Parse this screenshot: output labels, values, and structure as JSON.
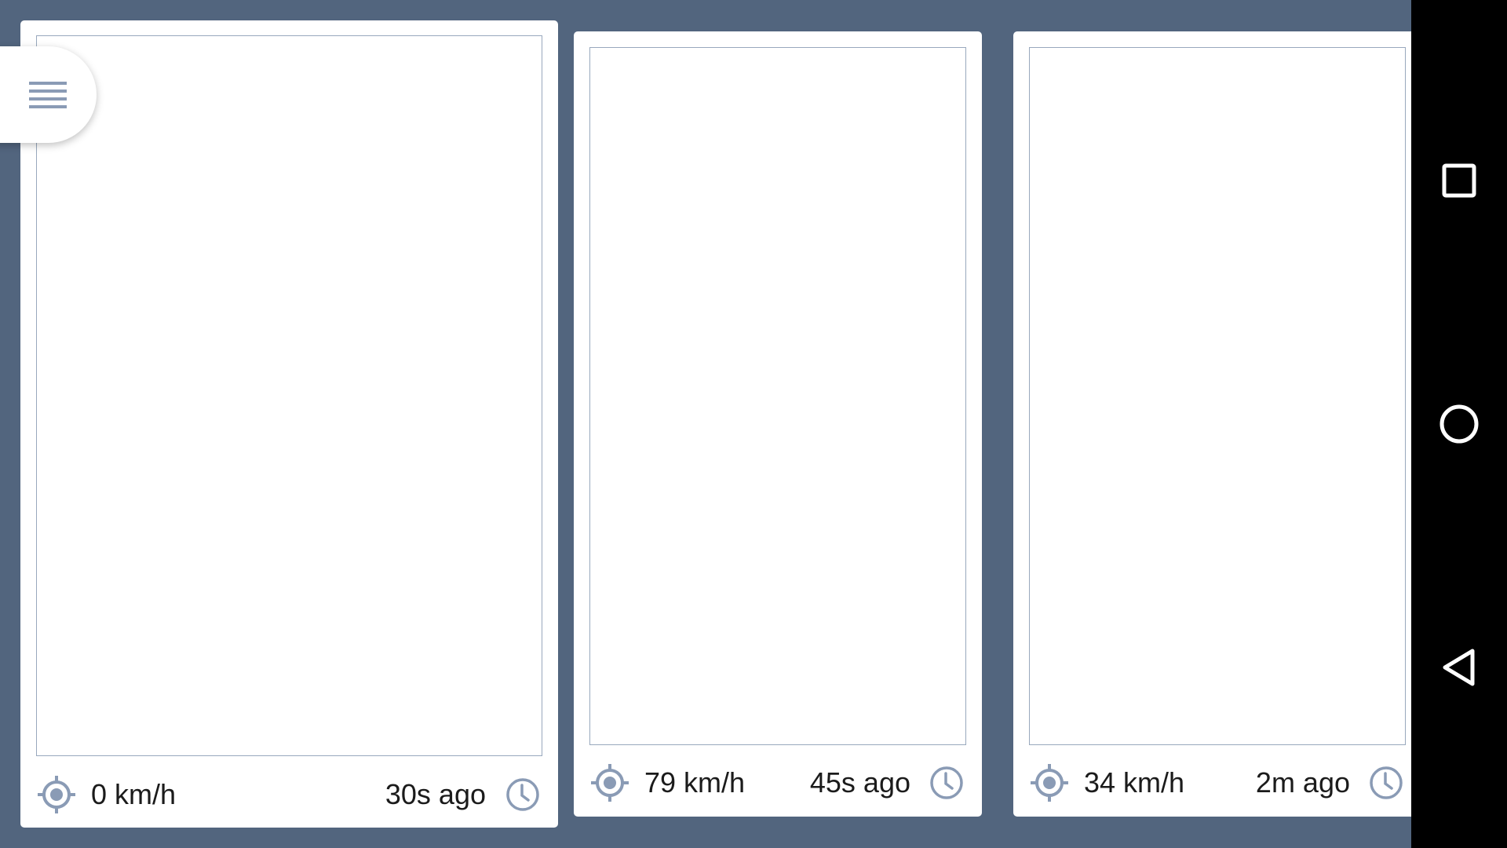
{
  "menu": {
    "icon": "hamburger-menu-icon"
  },
  "cards": [
    {
      "speed": "0 km/h",
      "age": "30s ago",
      "location_icon": "gps-location-icon",
      "time_icon": "clock-icon"
    },
    {
      "speed": "79 km/h",
      "age": "45s ago",
      "location_icon": "gps-location-icon",
      "time_icon": "clock-icon"
    },
    {
      "speed": "34 km/h",
      "age": "2m ago",
      "location_icon": "gps-location-icon",
      "time_icon": "clock-icon"
    }
  ],
  "navbar": {
    "buttons": [
      "recents-square-icon",
      "home-circle-icon",
      "back-triangle-icon"
    ]
  },
  "colors": {
    "background": "#52657e",
    "icon": "#8a9bb5",
    "card": "#ffffff",
    "navbar": "#000000"
  }
}
